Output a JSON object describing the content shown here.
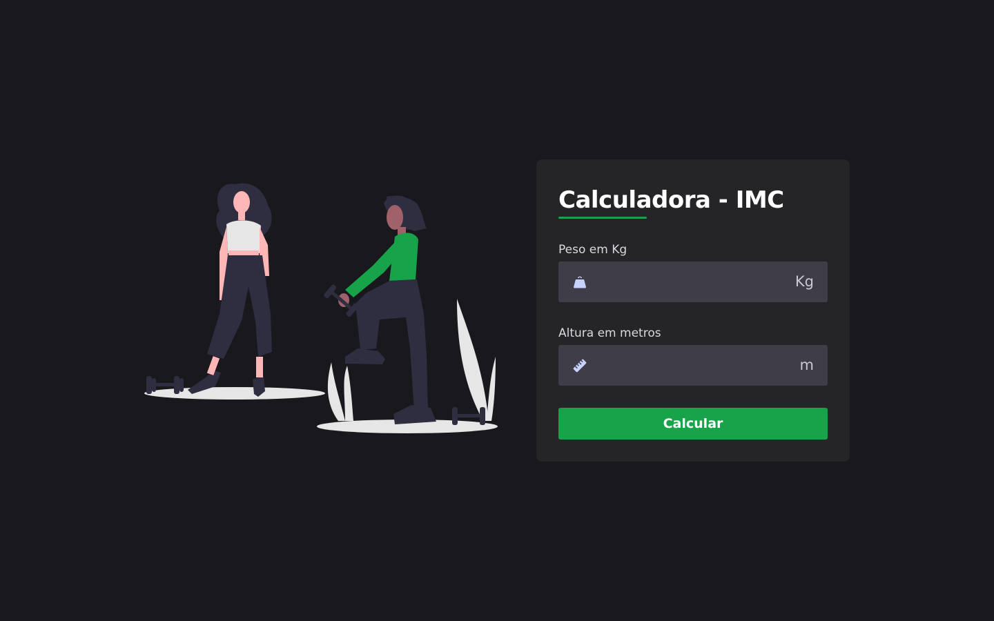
{
  "card": {
    "title": "Calculadora - IMC"
  },
  "weight": {
    "label": "Peso em Kg",
    "value": "",
    "placeholder": "",
    "unit": "Kg",
    "icon": "weight-bag-icon"
  },
  "height": {
    "label": "Altura em metros",
    "value": "",
    "placeholder": "",
    "unit": "m",
    "icon": "ruler-icon"
  },
  "button": {
    "label": "Calcular"
  },
  "colors": {
    "background": "#19181d",
    "card": "#252527",
    "field": "#3f3e48",
    "accent": "#16a34a",
    "illustration_shirt": "#16a34a",
    "illustration_dark": "#2f2e41",
    "illustration_skin": "#ffb6b6",
    "illustration_light": "#e6e6e6"
  }
}
